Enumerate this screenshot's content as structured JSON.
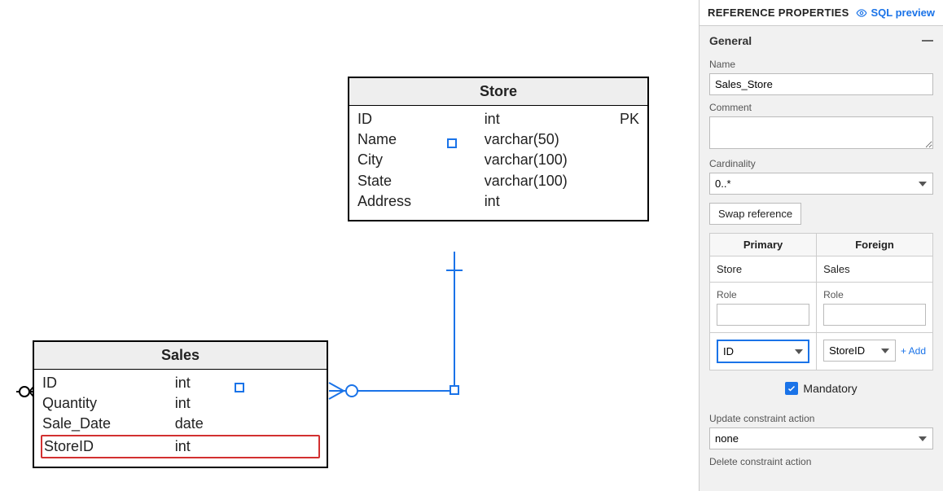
{
  "diagram": {
    "tables": {
      "store": {
        "name": "Store",
        "columns": [
          {
            "name": "ID",
            "type": "int",
            "key": "PK"
          },
          {
            "name": "Name",
            "type": "varchar(50)",
            "key": ""
          },
          {
            "name": "City",
            "type": "varchar(100)",
            "key": ""
          },
          {
            "name": "State",
            "type": "varchar(100)",
            "key": ""
          },
          {
            "name": "Address",
            "type": "int",
            "key": ""
          }
        ]
      },
      "sales": {
        "name": "Sales",
        "columns": [
          {
            "name": "ID",
            "type": "int",
            "key": ""
          },
          {
            "name": "Quantity",
            "type": "int",
            "key": ""
          },
          {
            "name": "Sale_Date",
            "type": "date",
            "key": ""
          },
          {
            "name": "StoreID",
            "type": "int",
            "key": "",
            "fk": true
          }
        ]
      }
    }
  },
  "panel": {
    "title": "REFERENCE PROPERTIES",
    "sql_preview": "SQL preview",
    "section_general": "General",
    "name_label": "Name",
    "name_value": "Sales_Store",
    "comment_label": "Comment",
    "comment_value": "",
    "cardinality_label": "Cardinality",
    "cardinality_value": "0..*",
    "swap_label": "Swap reference",
    "col_primary": "Primary",
    "col_foreign": "Foreign",
    "primary_entity": "Store",
    "foreign_entity": "Sales",
    "role_label": "Role",
    "primary_role": "",
    "foreign_role": "",
    "primary_key": "ID",
    "foreign_key": "StoreID",
    "add_link": "+ Add",
    "mandatory_label": "Mandatory",
    "update_action_label": "Update constraint action",
    "update_action_value": "none",
    "delete_action_label": "Delete constraint action"
  }
}
